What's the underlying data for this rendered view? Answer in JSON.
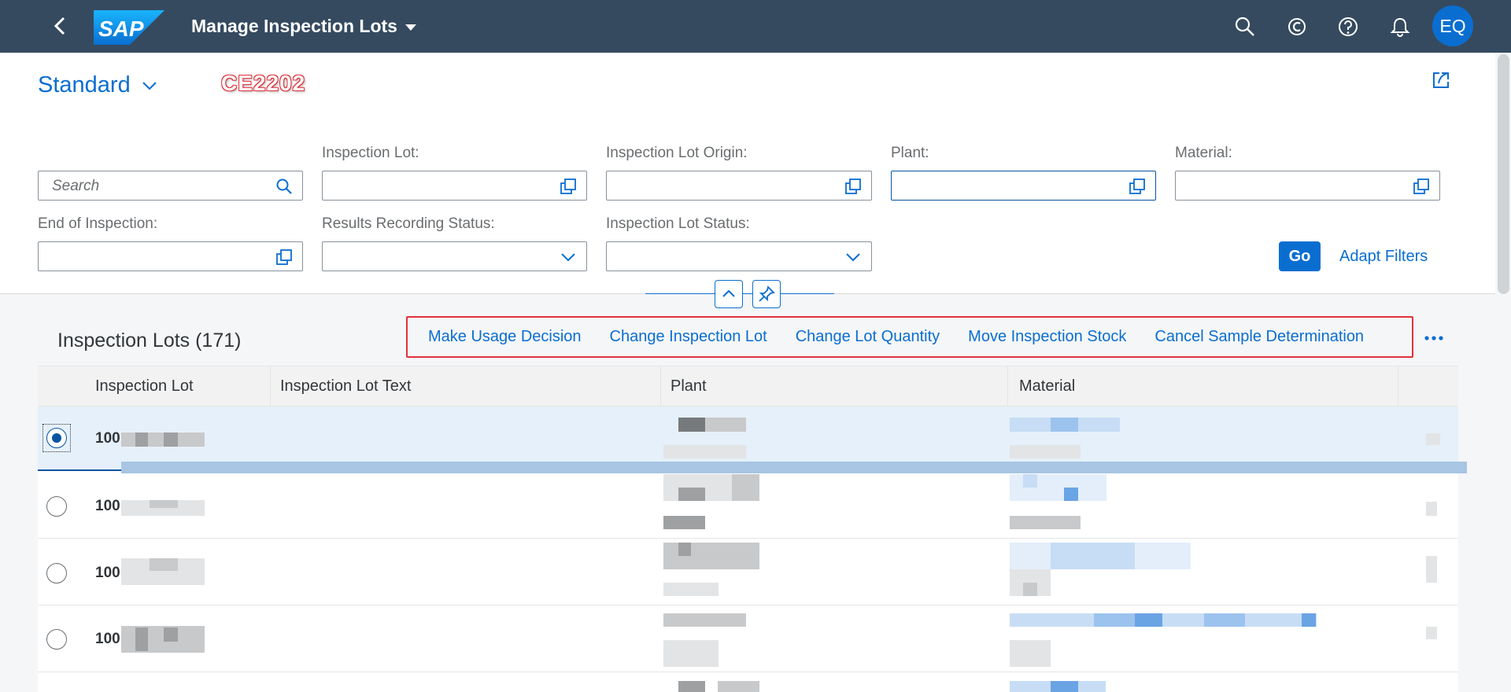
{
  "shell": {
    "logo_text": "SAP",
    "app_title": "Manage Inspection Lots",
    "avatar_initials": "EQ",
    "icons": [
      "search-icon",
      "copilot-icon",
      "help-icon",
      "notifications-icon"
    ]
  },
  "variant": {
    "name": "Standard",
    "stamp": "CE2202"
  },
  "filters": {
    "search_placeholder": "Search",
    "inspection_lot_label": "Inspection Lot:",
    "inspection_lot_origin_label": "Inspection Lot Origin:",
    "plant_label": "Plant:",
    "material_label": "Material:",
    "end_of_inspection_label": "End of Inspection:",
    "results_recording_status_label": "Results Recording Status:",
    "inspection_lot_status_label": "Inspection Lot Status:",
    "go_label": "Go",
    "adapt_filters_label": "Adapt Filters"
  },
  "table": {
    "title": "Inspection Lots (171)",
    "actions": [
      "Make Usage Decision",
      "Change Inspection Lot",
      "Change Lot Quantity",
      "Move Inspection Stock",
      "Cancel Sample Determination"
    ],
    "columns": [
      "Inspection Lot",
      "Inspection Lot Text",
      "Plant",
      "Material"
    ],
    "rows": [
      {
        "lot_prefix": "100",
        "selected": true
      },
      {
        "lot_prefix": "100",
        "selected": false
      },
      {
        "lot_prefix": "100",
        "selected": false
      },
      {
        "lot_prefix": "100",
        "selected": false
      }
    ]
  }
}
